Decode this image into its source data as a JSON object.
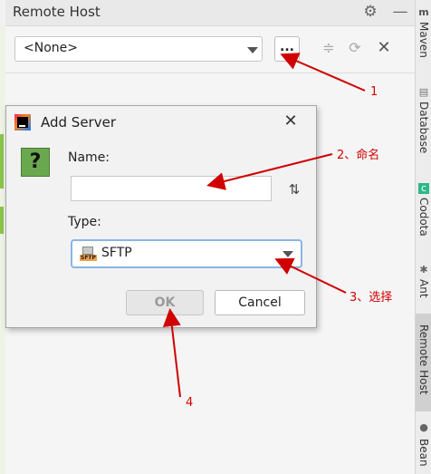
{
  "panel": {
    "title": "Remote Host",
    "toolbar": {
      "combo_value": "<None>",
      "browse_label": "..."
    }
  },
  "stripe": {
    "items": [
      {
        "label": "Maven"
      },
      {
        "label": "Database"
      },
      {
        "label": "Codota"
      },
      {
        "label": "Ant"
      },
      {
        "label": "Remote Host"
      },
      {
        "label": "Bean"
      }
    ]
  },
  "dialog": {
    "title": "Add Server",
    "name_label": "Name:",
    "name_value": "",
    "type_label": "Type:",
    "type_value": "SFTP",
    "ok_label": "OK",
    "cancel_label": "Cancel"
  },
  "annotations": [
    "1",
    "2、命名",
    "3、选择",
    "4"
  ],
  "colors": {
    "annotation": "#d00000",
    "selection_border": "#8ab4e6"
  }
}
